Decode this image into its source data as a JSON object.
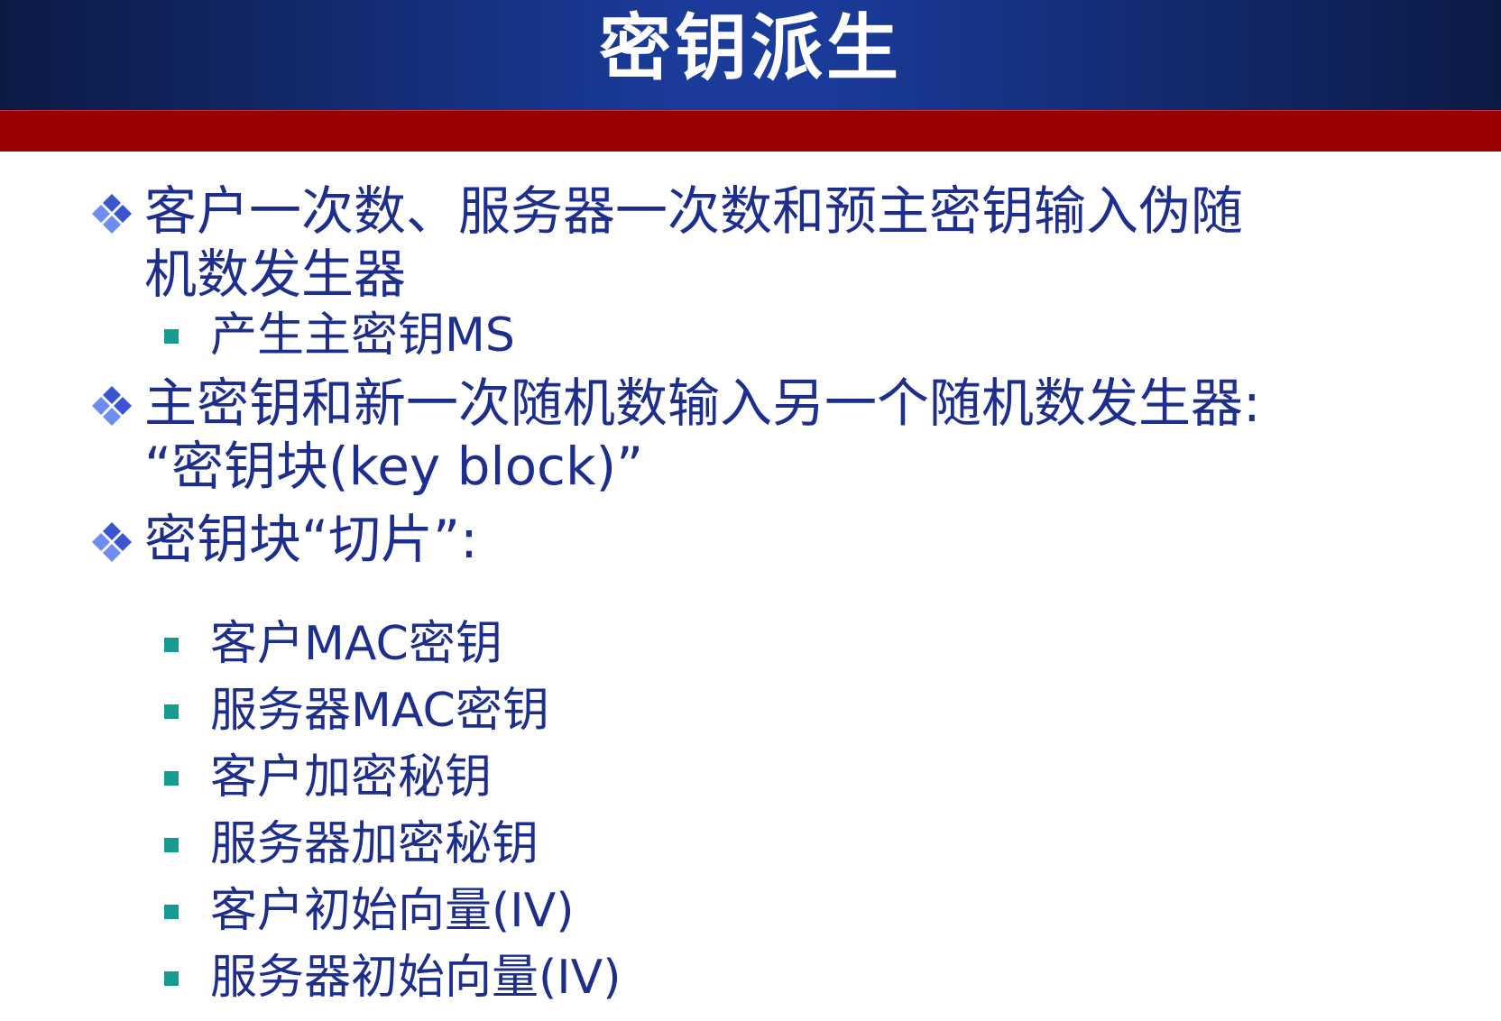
{
  "slide": {
    "title": "密钥派生",
    "colors": {
      "title_bar": "#1a3b9a",
      "band": "#990000",
      "text": "#1e2e8c",
      "bullet_l1": "#3b55d0",
      "bullet_l2": "#159b8f"
    },
    "bullets": [
      {
        "text": "客户一次数、服务器一次数和预主密钥输入伪随\n机数发生器",
        "children": [
          {
            "text": "产生主密钥MS"
          }
        ]
      },
      {
        "text": "主密钥和新一次随机数输入另一个随机数发生器:\n“密钥块(key block)”",
        "children": []
      },
      {
        "text": "密钥块“切片”:",
        "children": [
          {
            "text": "客户MAC密钥"
          },
          {
            "text": "服务器MAC密钥"
          },
          {
            "text": "客户加密秘钥"
          },
          {
            "text": "服务器加密秘钥"
          },
          {
            "text": "客户初始向量(IV)"
          },
          {
            "text": "服务器初始向量(IV)"
          }
        ]
      }
    ],
    "icons": {
      "level1": "diamond-bullet-icon",
      "level2": "square-bullet-icon"
    }
  }
}
